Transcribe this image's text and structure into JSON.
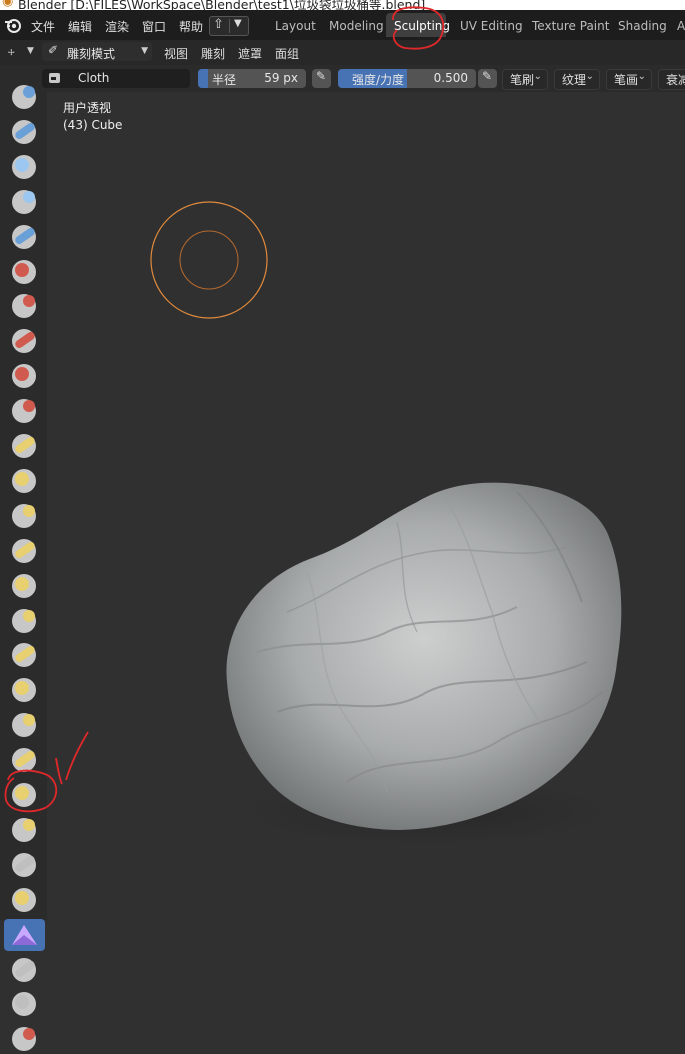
{
  "window": {
    "title": "Blender [D:\\FILES\\WorkSpace\\Blender\\test1\\垃圾袋垃圾桶等.blend]"
  },
  "menubar": {
    "items": [
      "文件",
      "编辑",
      "渲染",
      "窗口",
      "帮助"
    ],
    "workspace_tabs": [
      "Layout",
      "Modeling",
      "Sculpting",
      "UV Editing",
      "Texture Paint",
      "Shading",
      "A"
    ],
    "active_tab": "Sculpting"
  },
  "header": {
    "mode": "雕刻模式",
    "menus": [
      "视图",
      "雕刻",
      "遮罩",
      "面组"
    ]
  },
  "tool_settings": {
    "brush_name": "Cloth",
    "radius_label": "半径",
    "radius_value": "59 px",
    "strength_label": "强度/力度",
    "strength_value": "0.500",
    "strength_fraction": 0.5,
    "dropdowns": [
      "笔刷",
      "纹理",
      "笔画",
      "衰减"
    ]
  },
  "viewport": {
    "view_name": "用户透视",
    "object_info": "(43) Cube"
  },
  "toolbar": {
    "active_tool": "cloth-brush",
    "tool_count": 24
  },
  "colors": {
    "accent_blue": "#4772b3",
    "brush_cursor": "#e08a3c",
    "annotation_red": "#e0282a",
    "viewport_bg": "#303030"
  }
}
